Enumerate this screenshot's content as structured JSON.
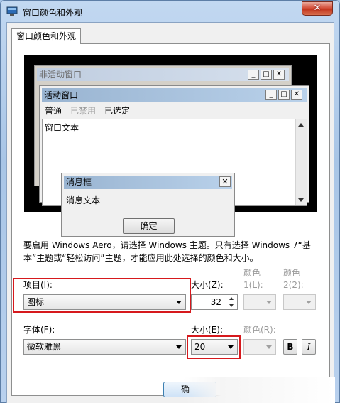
{
  "window": {
    "title": "窗口颜色和外观",
    "close_label": "✕"
  },
  "tab": {
    "label": "窗口颜色和外观"
  },
  "preview": {
    "inactive_title": "非活动窗口",
    "active_title": "活动窗口",
    "menu": {
      "normal": "普通",
      "disabled": "已禁用",
      "selected": "已选定"
    },
    "window_text": "窗口文本",
    "message_box": {
      "title": "消息框",
      "text": "消息文本",
      "ok_label": "确定"
    },
    "buttons": {
      "minimize": "_",
      "maximize": "□",
      "close": "✕"
    }
  },
  "description": "要启用 Windows Aero，请选择 Windows 主题。只有选择 Windows 7“基本”主题或“轻松访问”主题，才能应用此处选择的颜色和大小。",
  "item": {
    "label": "项目(I):",
    "value": "图标",
    "size_label": "大小(Z):",
    "size_value": "32",
    "color1_label": "颜色 1(L):",
    "color2_label": "颜色 2(2):"
  },
  "font": {
    "label": "字体(F):",
    "value": "微软雅黑",
    "size_label": "大小(E):",
    "size_value": "20",
    "color_label": "颜色(R):",
    "bold": "B",
    "italic": "I"
  },
  "footer": {
    "ok_label": "确"
  },
  "colors": {
    "highlight_box": "#d6191d"
  }
}
